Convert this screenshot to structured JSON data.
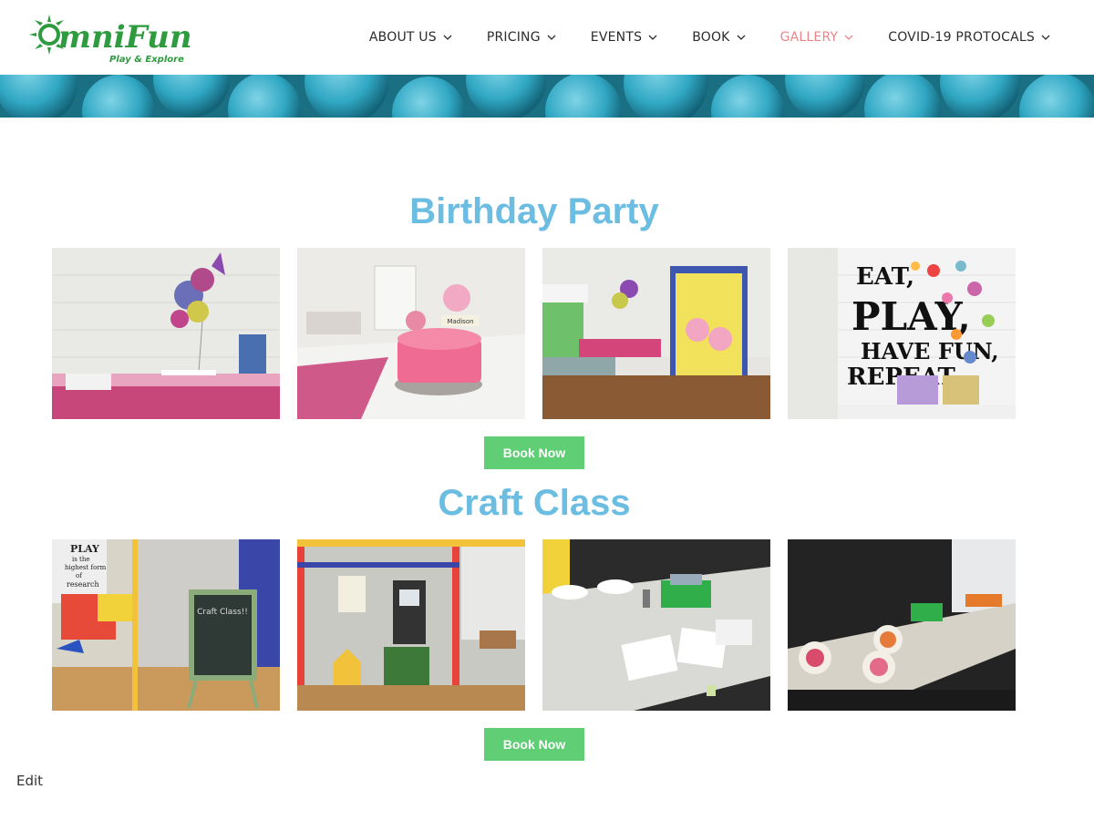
{
  "brand": {
    "name": "OmniFun",
    "tagline": "Play & Explore",
    "color": "#2e9b3e"
  },
  "nav": {
    "items": [
      {
        "label": "ABOUT US"
      },
      {
        "label": "PRICING"
      },
      {
        "label": "EVENTS"
      },
      {
        "label": "BOOK"
      },
      {
        "label": "GALLERY"
      },
      {
        "label": "COVID-19 PROTOCALS"
      }
    ],
    "active_color": "#e8858a"
  },
  "sections": [
    {
      "title": "Birthday Party",
      "button_label": "Book Now",
      "photos": [
        {
          "subject": "balloons-party-table"
        },
        {
          "subject": "pink-birthday-cake",
          "cake_topper_text": "Madison"
        },
        {
          "subject": "peppa-pig-party-wall"
        },
        {
          "subject": "eat-play-sign-wall",
          "sign_text": [
            "EAT,",
            "PLAY,",
            "HAVE FUN,",
            "REPEAT"
          ]
        }
      ]
    },
    {
      "title": "Craft Class",
      "button_label": "Book Now",
      "photos": [
        {
          "subject": "craft-class-chalkboard",
          "chalkboard_text": "Craft Class!!",
          "poster_text": [
            "PLAY",
            "is the",
            "highest form",
            "of",
            "research"
          ]
        },
        {
          "subject": "play-structure-crafts"
        },
        {
          "subject": "craft-table-supplies"
        },
        {
          "subject": "paper-plate-crafts"
        }
      ]
    }
  ],
  "footer": {
    "edit_label": "Edit"
  },
  "colors": {
    "section_title": "#6bbde2",
    "button": "#5fce74",
    "hero": "#1d7f93"
  }
}
